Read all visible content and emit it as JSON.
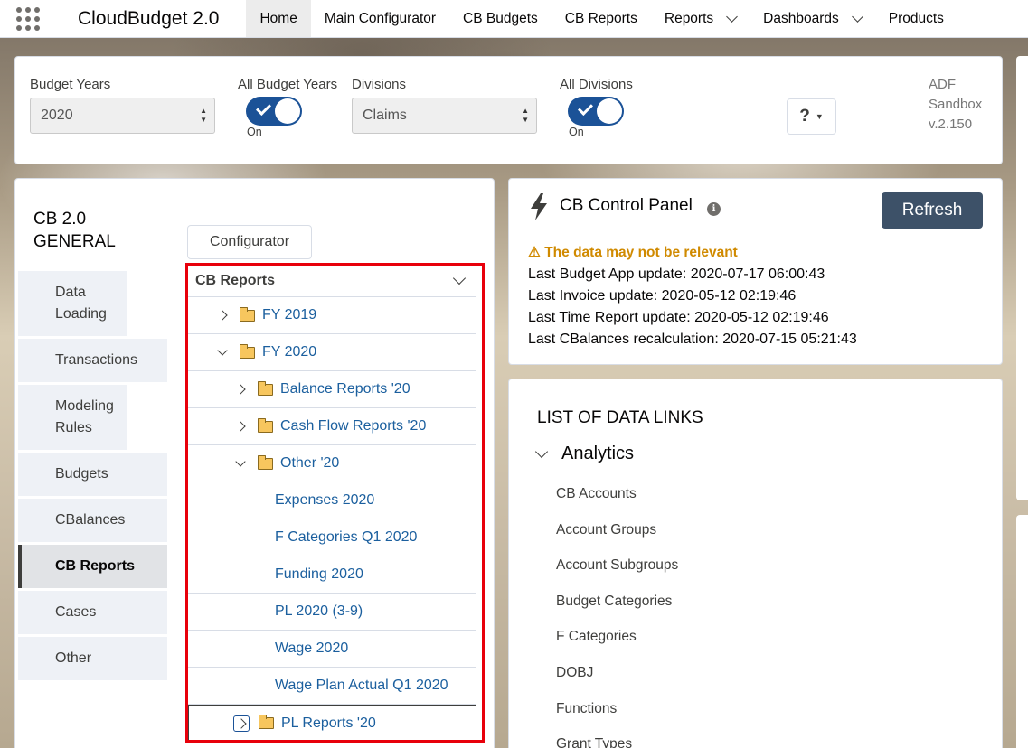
{
  "app": {
    "name": "CloudBudget 2.0"
  },
  "icons": {
    "app_launcher": "waffle-icon",
    "control_panel": "lightning-bolt-icon",
    "info": "info-icon",
    "warning": "warning-triangle-icon",
    "folder": "folder-icon"
  },
  "nav": {
    "items": [
      {
        "label": "Home",
        "active": true,
        "dropdown": false
      },
      {
        "label": "Main Configurator",
        "active": false,
        "dropdown": false
      },
      {
        "label": "CB Budgets",
        "active": false,
        "dropdown": false
      },
      {
        "label": "CB Reports",
        "active": false,
        "dropdown": false
      },
      {
        "label": "Reports",
        "active": false,
        "dropdown": true
      },
      {
        "label": "Dashboards",
        "active": false,
        "dropdown": true
      },
      {
        "label": "Products",
        "active": false,
        "dropdown": false
      }
    ]
  },
  "filters": {
    "budget_years_label": "Budget Years",
    "budget_year_value": "2020",
    "all_budget_years_label": "All Budget Years",
    "all_budget_years_state": "On",
    "divisions_label": "Divisions",
    "division_value": "Claims",
    "all_divisions_label": "All Divisions",
    "all_divisions_state": "On",
    "help_label": "?",
    "version_lines": [
      "ADF",
      "Sandbox",
      "v.2.150"
    ]
  },
  "general": {
    "title": "CB 2.0 GENERAL",
    "configurator_label": "Configurator",
    "sidebar": [
      {
        "label": "Data Loading",
        "active": false
      },
      {
        "label": "Transactions",
        "active": false
      },
      {
        "label": "Modeling Rules",
        "active": false
      },
      {
        "label": "Budgets",
        "active": false
      },
      {
        "label": "CBalances",
        "active": false
      },
      {
        "label": "CB Reports",
        "active": true
      },
      {
        "label": "Cases",
        "active": false
      },
      {
        "label": "Other",
        "active": false
      }
    ],
    "tree": {
      "header": "CB Reports",
      "rows": [
        {
          "label": "FY 2019",
          "level": 0,
          "type": "folder",
          "expanded": false
        },
        {
          "label": "FY 2020",
          "level": 0,
          "type": "folder",
          "expanded": true
        },
        {
          "label": "Balance Reports '20",
          "level": 1,
          "type": "folder",
          "expanded": false
        },
        {
          "label": "Cash Flow Reports '20",
          "level": 1,
          "type": "folder",
          "expanded": false
        },
        {
          "label": "Other '20",
          "level": 1,
          "type": "folder",
          "expanded": true
        },
        {
          "label": "Expenses 2020",
          "level": 2,
          "type": "report"
        },
        {
          "label": "F Categories Q1 2020",
          "level": 2,
          "type": "report"
        },
        {
          "label": "Funding 2020",
          "level": 2,
          "type": "report"
        },
        {
          "label": "PL 2020 (3-9)",
          "level": 2,
          "type": "report"
        },
        {
          "label": "Wage 2020",
          "level": 2,
          "type": "report"
        },
        {
          "label": "Wage Plan Actual Q1 2020",
          "level": 2,
          "type": "report"
        },
        {
          "label": "PL Reports '20",
          "level": 1,
          "type": "folder",
          "expanded": false,
          "focused": true
        }
      ]
    }
  },
  "control_panel": {
    "title": "CB Control Panel",
    "refresh_label": "Refresh",
    "warning": "The data may not be relevant",
    "warning_color": "#d08a00",
    "lines": [
      "Last Budget App update: 2020-07-17 06:00:43",
      "Last Invoice update: 2020-05-12 02:19:46",
      "Last Time Report update: 2020-05-12 02:19:46",
      "Last CBalances recalculation: 2020-07-15 05:21:43"
    ]
  },
  "data_links": {
    "title": "LIST OF DATA LINKS",
    "section": "Analytics",
    "items": [
      "CB Accounts",
      "Account Groups",
      "Account Subgroups",
      "Budget Categories",
      "F Categories",
      "DOBJ",
      "Functions",
      "Grant Types"
    ]
  },
  "colors": {
    "toggle_on": "#1b5297",
    "refresh_bg": "#3d5168",
    "link": "#1b5f9e",
    "highlight_border": "#e8000b"
  }
}
